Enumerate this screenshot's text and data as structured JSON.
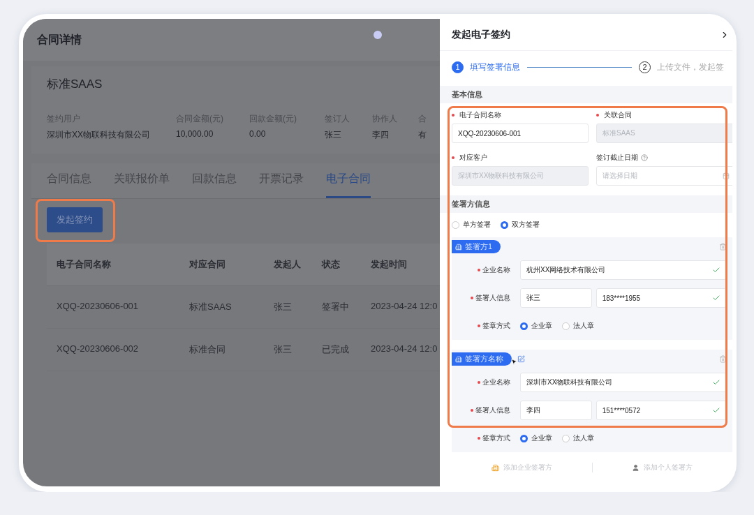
{
  "page": {
    "title": "合同详情"
  },
  "contract": {
    "name": "标准SAAS",
    "fields": [
      {
        "label": "签约用户",
        "value": "深圳市XX物联科技有限公司"
      },
      {
        "label": "合同金额(元)",
        "value": "10,000.00"
      },
      {
        "label": "回款金额(元)",
        "value": "0.00"
      },
      {
        "label": "签订人",
        "value": "张三"
      },
      {
        "label": "协作人",
        "value": "李四"
      },
      {
        "label": "合",
        "value": "有"
      }
    ]
  },
  "tabs": [
    {
      "label": "合同信息",
      "selected": false
    },
    {
      "label": "关联报价单",
      "selected": false
    },
    {
      "label": "回款信息",
      "selected": false
    },
    {
      "label": "开票记录",
      "selected": false
    },
    {
      "label": "电子合同",
      "selected": true
    }
  ],
  "primary_button": "发起签约",
  "table": {
    "columns": [
      "电子合同名称",
      "对应合同",
      "发起人",
      "状态",
      "发起时间"
    ],
    "rows": [
      [
        "XQQ-20230606-001",
        "标准SAAS",
        "张三",
        "签署中",
        "2023-04-24 12:0"
      ],
      [
        "XQQ-20230606-002",
        "标准合同",
        "张三",
        "已完成",
        "2023-04-24 12:0"
      ]
    ]
  },
  "drawer": {
    "title": "发起电子签约",
    "steps": [
      {
        "number": "1",
        "label": "填写签署信息",
        "active": true
      },
      {
        "number": "2",
        "label": "上传文件，发起签",
        "active": false
      }
    ],
    "basic_info": {
      "heading": "基本信息",
      "fields": [
        {
          "kind": "text",
          "label": "电子合同名称",
          "required": true,
          "value": "XQQ-20230606-001",
          "disabled": false
        },
        {
          "kind": "text",
          "label": "关联合同",
          "required": true,
          "value": "标准SAAS",
          "disabled": true
        },
        {
          "kind": "text",
          "label": "对应客户",
          "required": true,
          "value": "深圳市XX物联科技有限公司",
          "disabled": true
        },
        {
          "kind": "date",
          "label": "签订截止日期",
          "required": false,
          "placeholder": "请选择日期",
          "disabled": false,
          "help": true
        }
      ]
    },
    "signers": {
      "heading": "签署方信息",
      "modes": [
        {
          "label": "单方签署",
          "selected": false
        },
        {
          "label": "双方签署",
          "selected": true
        }
      ],
      "parties": [
        {
          "tag": "签署方1",
          "editable": false,
          "rows": [
            {
              "kind": "company",
              "label": "企业名称",
              "required": true,
              "value": "杭州XX网络技术有限公司",
              "valid": true
            },
            {
              "kind": "person",
              "label": "签署人信息",
              "required": true,
              "name": "张三",
              "phone": "183****1955",
              "valid": true
            },
            {
              "kind": "seal",
              "label": "签章方式",
              "required": true,
              "options": [
                {
                  "label": "企业章",
                  "selected": true
                },
                {
                  "label": "法人章",
                  "selected": false
                }
              ]
            }
          ]
        },
        {
          "tag": "签署方名称",
          "editable": true,
          "rows": [
            {
              "kind": "company",
              "label": "企业名称",
              "required": true,
              "value": "深圳市XX物联科技有限公司",
              "valid": true
            },
            {
              "kind": "person",
              "label": "签署人信息",
              "required": true,
              "name": "李四",
              "phone": "151****0572",
              "valid": true
            },
            {
              "kind": "seal",
              "label": "签章方式",
              "required": true,
              "options": [
                {
                  "label": "企业章",
                  "selected": true
                },
                {
                  "label": "法人章",
                  "selected": false
                }
              ]
            }
          ]
        }
      ]
    },
    "actions": [
      {
        "kind": "company",
        "label": "添加企业签署方"
      },
      {
        "kind": "person",
        "label": "添加个人签署方"
      }
    ]
  }
}
